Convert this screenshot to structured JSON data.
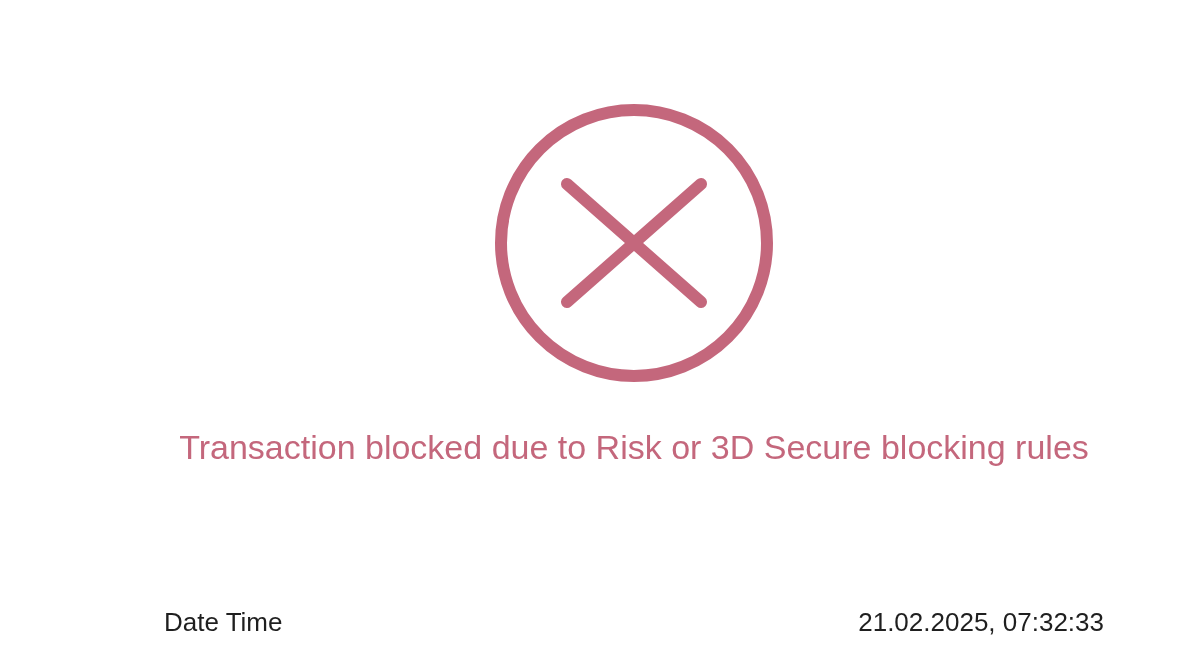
{
  "status": {
    "kind": "error",
    "message": "Transaction blocked due to Risk or 3D Secure blocking rules"
  },
  "details": [
    {
      "label": "Date Time",
      "value": "21.02.2025, 07:32:33"
    }
  ]
}
